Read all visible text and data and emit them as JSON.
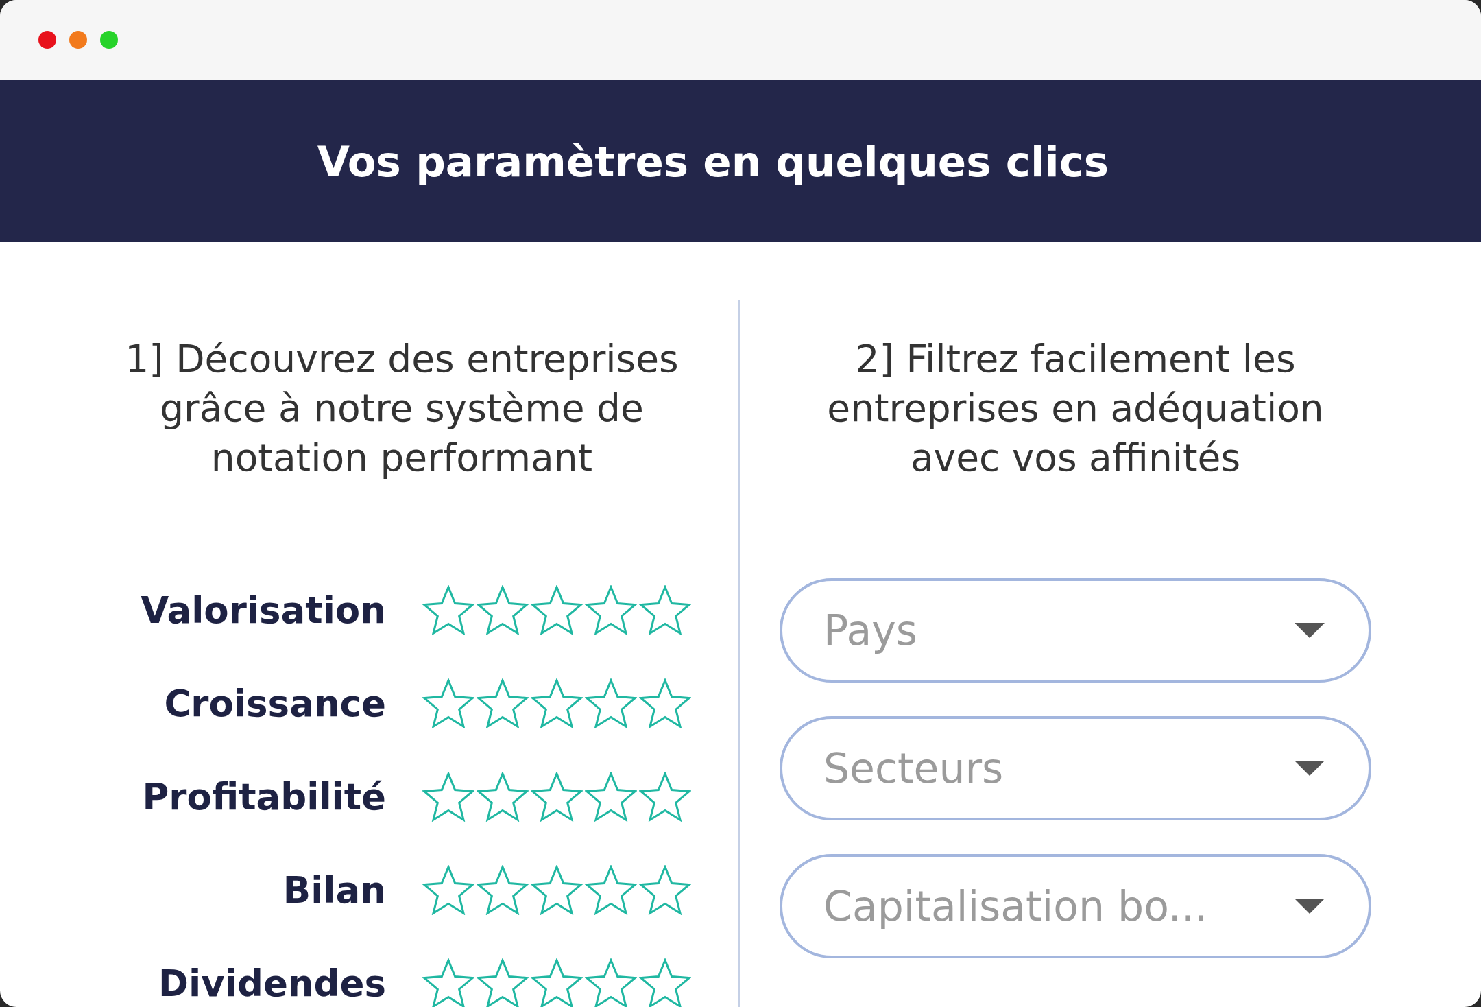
{
  "window": {
    "controls": [
      {
        "color": "#e8121c"
      },
      {
        "color": "#f27a1c"
      },
      {
        "color": "#27d32a"
      }
    ]
  },
  "header": {
    "title": "Vos paramètres en quelques clics"
  },
  "rating_section": {
    "heading": [
      "1] Découvrez des entreprises",
      "grâce à notre système de",
      "notation performant"
    ],
    "criteria": [
      {
        "label": "Valorisation",
        "stars": 0
      },
      {
        "label": "Croissance",
        "stars": 0
      },
      {
        "label": "Profitabilité",
        "stars": 0
      },
      {
        "label": "Bilan",
        "stars": 0
      },
      {
        "label": "Dividendes",
        "stars": 0
      }
    ]
  },
  "filter_section": {
    "heading": [
      "2] Filtrez facilement les",
      "entreprises en adéquation",
      "avec vos affinités"
    ],
    "dropdowns": [
      {
        "placeholder": "Pays"
      },
      {
        "placeholder": "Secteurs"
      },
      {
        "placeholder": "Capitalisation bo..."
      }
    ]
  }
}
